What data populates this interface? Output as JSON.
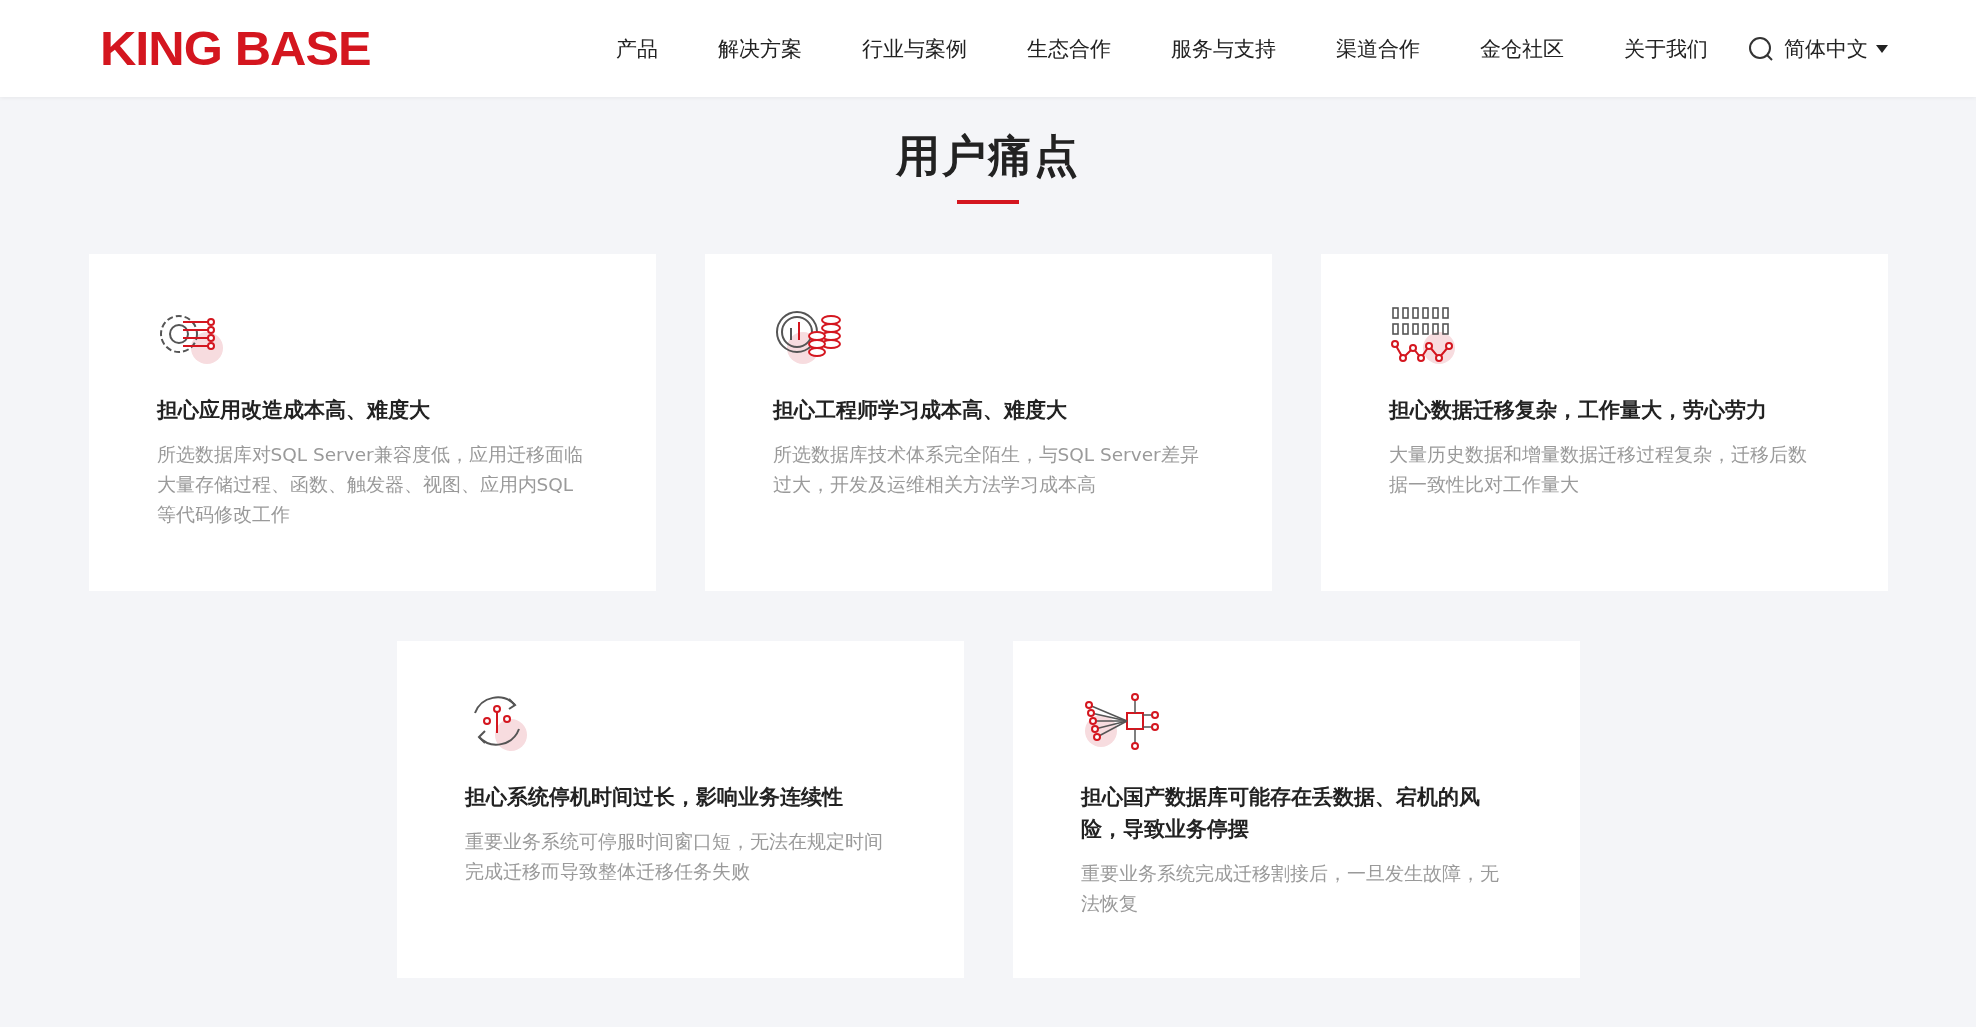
{
  "header": {
    "logo": "KING BASE",
    "nav": [
      {
        "label": "产品"
      },
      {
        "label": "解决方案"
      },
      {
        "label": "行业与案例"
      },
      {
        "label": "生态合作"
      },
      {
        "label": "服务与支持"
      },
      {
        "label": "渠道合作"
      },
      {
        "label": "金仓社区"
      },
      {
        "label": "关于我们"
      }
    ],
    "language": "简体中文"
  },
  "section": {
    "title": "用户痛点",
    "cards": [
      {
        "kind": "gear",
        "title": "担心应用改造成本高、难度大",
        "text": "所选数据库对SQL Server兼容度低，应用迁移面临大量存储过程、函数、触发器、视图、应用内SQL等代码修改工作"
      },
      {
        "kind": "coins",
        "title": "担心工程师学习成本高、难度大",
        "text": "所选数据库技术体系完全陌生，与SQL Server差异过大，开发及运维相关方法学习成本高"
      },
      {
        "kind": "binary",
        "title": "担心数据迁移复杂，工作量大，劳心劳力",
        "text": "大量历史数据和增量数据迁移过程复杂，迁移后数据一致性比对工作量大"
      },
      {
        "kind": "cycle",
        "title": "担心系统停机时间过长，影响业务连续性",
        "text": "重要业务系统可停服时间窗口短，无法在规定时间完成迁移而导致整体迁移任务失败"
      },
      {
        "kind": "chip",
        "title": "担心国产数据库可能存在丢数据、宕机的风险，导致业务停摆",
        "text": "重要业务系统完成迁移割接后，一旦发生故障，无法恢复"
      }
    ]
  }
}
